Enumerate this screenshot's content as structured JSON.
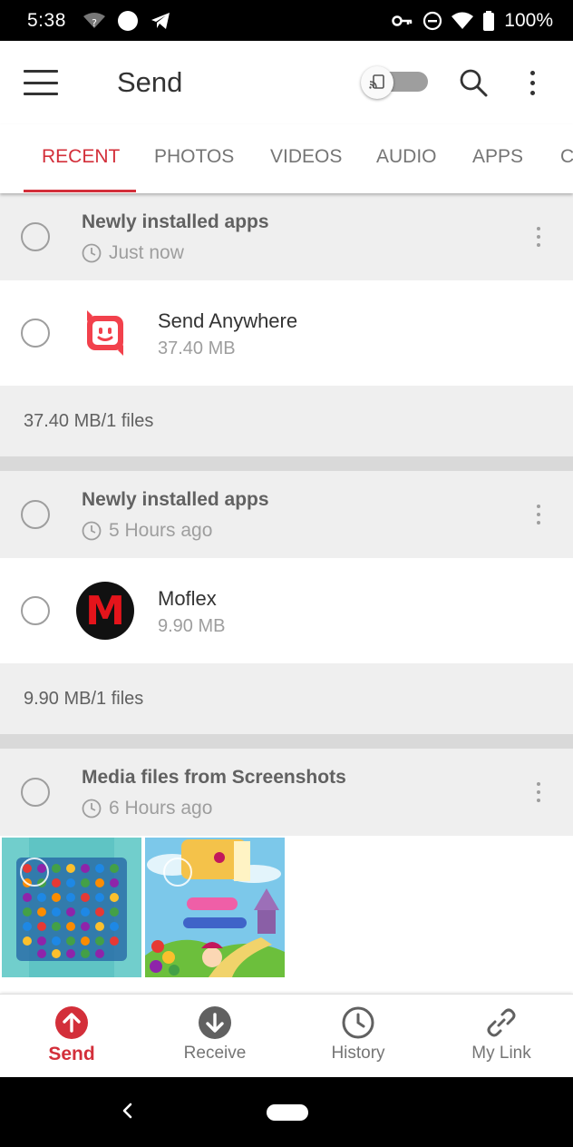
{
  "status_bar": {
    "time": "5:38",
    "battery": "100%"
  },
  "app_bar": {
    "title": "Send"
  },
  "tabs": [
    {
      "label": "RECENT",
      "active": true
    },
    {
      "label": "PHOTOS"
    },
    {
      "label": "VIDEOS"
    },
    {
      "label": "AUDIO"
    },
    {
      "label": "APPS"
    },
    {
      "label": "C"
    }
  ],
  "groups": [
    {
      "title": "Newly installed apps",
      "time": "Just now",
      "file": {
        "name": "Send Anywhere",
        "size": "37.40 MB",
        "icon": "send-anywhere-app-icon"
      },
      "summary": "37.40 MB/1 files"
    },
    {
      "title": "Newly installed apps",
      "time": "5 Hours ago",
      "file": {
        "name": "Moflex",
        "size": "9.90 MB",
        "icon": "moflex-app-icon",
        "icon_letter": "M"
      },
      "summary": "9.90 MB/1 files"
    },
    {
      "title": "Media files from Screenshots",
      "time": "6 Hours ago",
      "thumbnails": [
        "candy-crush-board-screenshot",
        "candy-crush-title-screenshot"
      ]
    }
  ],
  "bottom_nav": [
    {
      "label": "Send",
      "icon": "upload-arrow-icon",
      "active": true
    },
    {
      "label": "Receive",
      "icon": "download-arrow-icon"
    },
    {
      "label": "History",
      "icon": "clock-icon"
    },
    {
      "label": "My Link",
      "icon": "link-icon"
    }
  ],
  "colors": {
    "accent": "#d32f3a",
    "header_bg": "#efefef",
    "divider": "#d9d9d9"
  }
}
